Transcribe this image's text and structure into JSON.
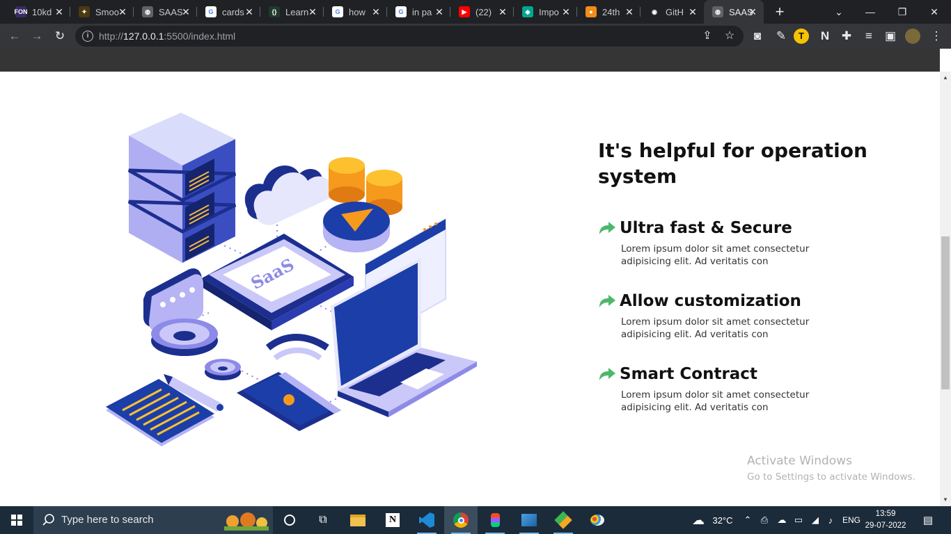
{
  "browser": {
    "tabs": [
      {
        "title": "10kd",
        "fav_color": "#3a2b64",
        "fav_text": "FON"
      },
      {
        "title": "Smoo",
        "fav_color": "#4a3a10",
        "fav_text": "✦"
      },
      {
        "title": "SAAS",
        "fav_color": "#5f6368",
        "fav_text": "◍"
      },
      {
        "title": "cards",
        "fav_color": "#ffffff",
        "fav_text": "G"
      },
      {
        "title": "Learn",
        "fav_color": "#1e3a2a",
        "fav_text": "{}"
      },
      {
        "title": "how",
        "fav_color": "#ffffff",
        "fav_text": "G"
      },
      {
        "title": "in pa",
        "fav_color": "#ffffff",
        "fav_text": "G"
      },
      {
        "title": "(22)",
        "fav_color": "#ff0000",
        "fav_text": "▶"
      },
      {
        "title": "Impo",
        "fav_color": "#00a88f",
        "fav_text": "◆"
      },
      {
        "title": "24th",
        "fav_color": "#f28c1a",
        "fav_text": "●"
      },
      {
        "title": "GitH",
        "fav_color": "#202124",
        "fav_text": "◉"
      },
      {
        "title": "SAAS",
        "fav_color": "#5f6368",
        "fav_text": "◍"
      }
    ],
    "new_tab": "+",
    "url_prefix": "http://",
    "url_host": "127.0.0.1",
    "url_rest": ":5500/index.html",
    "profile_initial": "T"
  },
  "content": {
    "heading": "It's helpful for operation system",
    "features": [
      {
        "title": "Ultra fast & Secure",
        "desc": "Lorem ipsum dolor sit amet consectetur adipisicing elit. Ad veritatis con"
      },
      {
        "title": "Allow customization",
        "desc": "Lorem ipsum dolor sit amet consectetur adipisicing elit. Ad veritatis con"
      },
      {
        "title": "Smart Contract",
        "desc": "Lorem ipsum dolor sit amet consectetur adipisicing elit. Ad veritatis con"
      }
    ],
    "illustration_label": "SaaS",
    "accent": "#4cb86b"
  },
  "watermark": {
    "line1": "Activate Windows",
    "line2": "Go to Settings to activate Windows."
  },
  "taskbar": {
    "search_placeholder": "Type here to search",
    "temperature": "32°C",
    "language": "ENG",
    "time": "13:59",
    "date": "29-07-2022"
  }
}
